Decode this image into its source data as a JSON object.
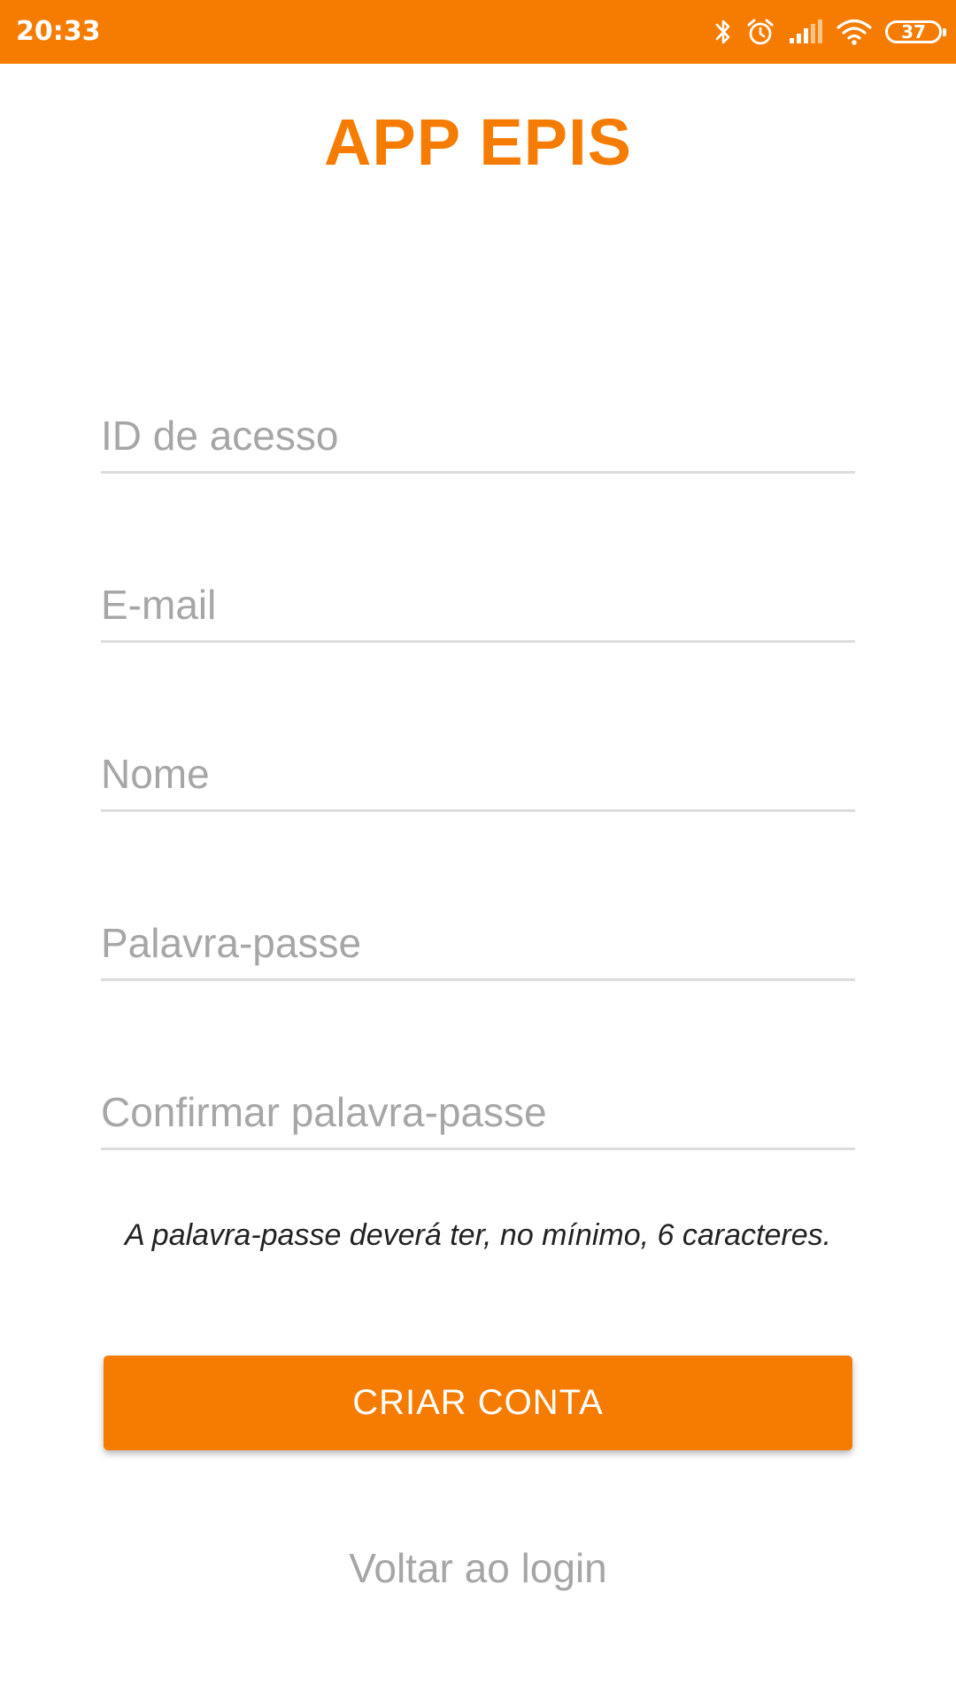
{
  "status_bar": {
    "time": "20:33",
    "battery": "37",
    "background_color": "#f57c00",
    "icons": [
      "bluetooth-icon",
      "alarm-icon",
      "signal-icon",
      "wifi-icon",
      "battery-icon"
    ]
  },
  "header": {
    "title": "APP EPIS",
    "accent_color": "#f57c00"
  },
  "form": {
    "fields": [
      {
        "placeholder": "ID de acesso",
        "value": ""
      },
      {
        "placeholder": "E-mail",
        "value": ""
      },
      {
        "placeholder": "Nome",
        "value": ""
      },
      {
        "placeholder": "Palavra-passe",
        "value": ""
      },
      {
        "placeholder": "Confirmar palavra-passe",
        "value": ""
      }
    ],
    "hint": "A palavra-passe deverá ter, no mínimo, 6 caracteres."
  },
  "actions": {
    "create_account_label": "CRIAR CONTA",
    "back_to_login_label": "Voltar ao login"
  }
}
